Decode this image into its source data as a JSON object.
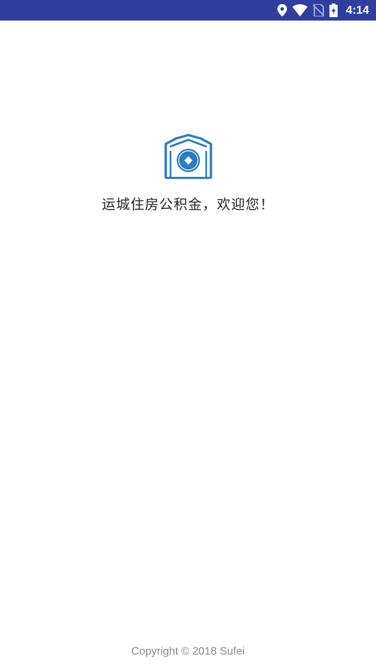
{
  "status_bar": {
    "time": "4:14",
    "icons": [
      "location-icon",
      "wifi-icon",
      "no-sim-icon",
      "battery-charging-icon"
    ],
    "background_color": "#303f9f"
  },
  "splash": {
    "welcome_text": "运城住房公积金，欢迎您！",
    "copyright": "Copyright © 2018 Sufei",
    "logo_color": "#2b7dbd"
  }
}
